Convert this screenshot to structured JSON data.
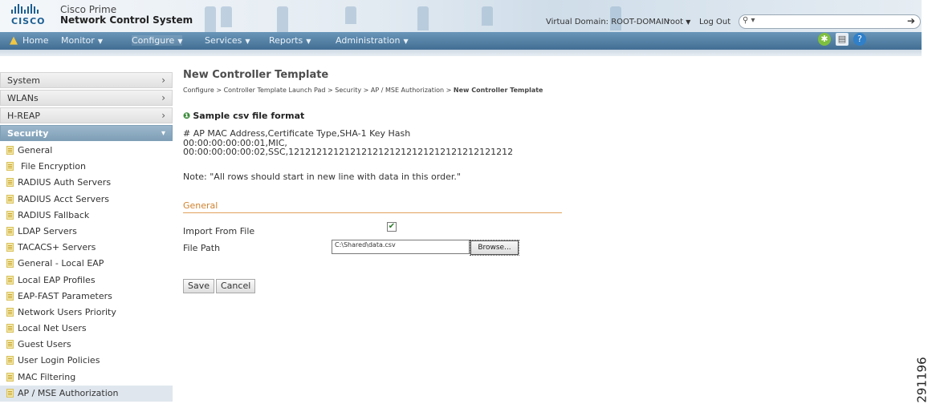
{
  "header": {
    "logo_text": "CISCO",
    "product_line1": "Cisco Prime",
    "product_line2": "Network Control System",
    "virtual_domain": "Virtual Domain: ROOT-DOMAIN",
    "user": "root",
    "logout": "Log Out",
    "search_placeholder": ""
  },
  "menu": {
    "items": [
      {
        "label": "Home"
      },
      {
        "label": "Monitor"
      },
      {
        "label": "Configure"
      },
      {
        "label": "Services"
      },
      {
        "label": "Reports"
      },
      {
        "label": "Administration"
      }
    ]
  },
  "sidebar": {
    "categories": [
      {
        "label": "System"
      },
      {
        "label": "WLANs"
      },
      {
        "label": "H-REAP"
      },
      {
        "label": "Security"
      }
    ],
    "items": [
      {
        "label": "General"
      },
      {
        "label": "File Encryption"
      },
      {
        "label": "RADIUS Auth Servers"
      },
      {
        "label": "RADIUS Acct Servers"
      },
      {
        "label": "RADIUS Fallback"
      },
      {
        "label": "LDAP Servers"
      },
      {
        "label": "TACACS+ Servers"
      },
      {
        "label": "General - Local EAP"
      },
      {
        "label": "Local EAP Profiles"
      },
      {
        "label": "EAP-FAST Parameters"
      },
      {
        "label": "Network Users Priority"
      },
      {
        "label": "Local Net Users"
      },
      {
        "label": "Guest Users"
      },
      {
        "label": "User Login Policies"
      },
      {
        "label": "MAC Filtering"
      },
      {
        "label": "AP / MSE Authorization"
      }
    ]
  },
  "main": {
    "title": "New Controller Template",
    "breadcrumb_path": "Configure > Controller Template Launch Pad > Security > AP / MSE Authorization > ",
    "breadcrumb_current": "New Controller Template",
    "info_title": "Sample csv file format",
    "csv_line1": "# AP MAC Address,Certificate Type,SHA-1 Key Hash",
    "csv_line2": "00:00:00:00:00:01,MIC,",
    "csv_line3": "00:00:00:00:00:02,SSC,1212121212121212121212121212121212121212",
    "note": "Note: \"All rows should start in new line with data in this order.\"",
    "section_general": "General",
    "import_label": "Import From File",
    "import_checked": true,
    "file_path_label": "File Path",
    "file_path_value": "C:\\Shared\\data.csv",
    "browse_label": "Browse...",
    "save_label": "Save",
    "cancel_label": "Cancel"
  },
  "figure_code": "291196"
}
